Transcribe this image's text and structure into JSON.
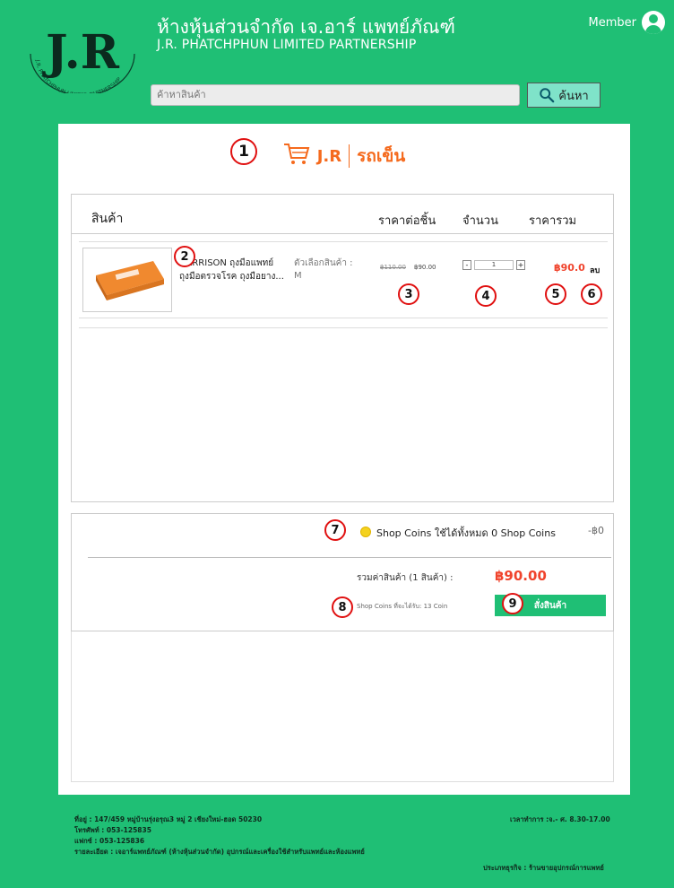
{
  "header": {
    "logo_text": "J.R",
    "logo_ring_text": "J.R. PHATCHPHUN LIMITED PARTNERSHIP",
    "company_th": "ห้างหุ้นส่วนจำกัด เจ.อาร์ แพทย์ภัณฑ์",
    "company_en": "J.R. PHATCHPHUN LIMITED PARTNERSHIP",
    "member_label": "Member",
    "search": {
      "placeholder": "ค้าหาสินค้า",
      "button_label": "ค้นหา"
    }
  },
  "cart": {
    "brand": "J.R",
    "title": "รถเข็น",
    "columns": {
      "product": "สินค้า",
      "unit_price": "ราคาต่อชิ้น",
      "quantity": "จำนวน",
      "total": "ราคารวม"
    },
    "items": [
      {
        "name": "HARRISON ถุงมือแพทย์ ถุงมือตรวจโรค ถุงมือยาง...",
        "option_label": "ตัวเลือกสินค้า :",
        "option_value": "M",
        "price_old": "฿110.00",
        "price_new": "฿90.00",
        "qty_minus": "-",
        "qty": "1",
        "qty_plus": "+",
        "line_total": "฿90.0",
        "delete_label": "ลบ"
      }
    ],
    "coins_text": "Shop Coins ใช้ได้ทั้งหมด 0 Shop Coins",
    "coins_amount": "-฿0",
    "subtotal_label": "รวมค่าสินค้า (1 สินค้า) :",
    "subtotal_value": "฿90.00",
    "coins_earn": "Shop Coins ที่จะได้รับ: 13 Coin",
    "checkout_label": "สั่งสินค้า"
  },
  "annotations": [
    "1",
    "2",
    "3",
    "4",
    "5",
    "6",
    "7",
    "8",
    "9"
  ],
  "footer": {
    "address": "ที่อยู่ : 147/459 หมู่บ้านรุ่งอรุณ3 หมู่ 2 เชียงใหม่-ฮอด 50230",
    "phone": "โทรศัพท์ : 053-125835",
    "fax": "แฟกซ์ : 053-125836",
    "details": "รายละเอียด : เจอาร์แพทย์ภัณฑ์ (ห้างหุ้นส่วนจำกัด) อุปกรณ์และเครื่องใช้สำหรับแพทย์และห้องแพทย์",
    "hours": "เวลาทำการ :จ.- ศ. 8.30-17.00",
    "business_type": "ประเภทธุรกิจ : ร้านขายอุปกรณ์การแพทย์"
  },
  "colors": {
    "brand_green": "#1fbf75",
    "accent_orange": "#f56a1d",
    "price_red": "#f0432c",
    "annotation_red": "#e01010"
  }
}
